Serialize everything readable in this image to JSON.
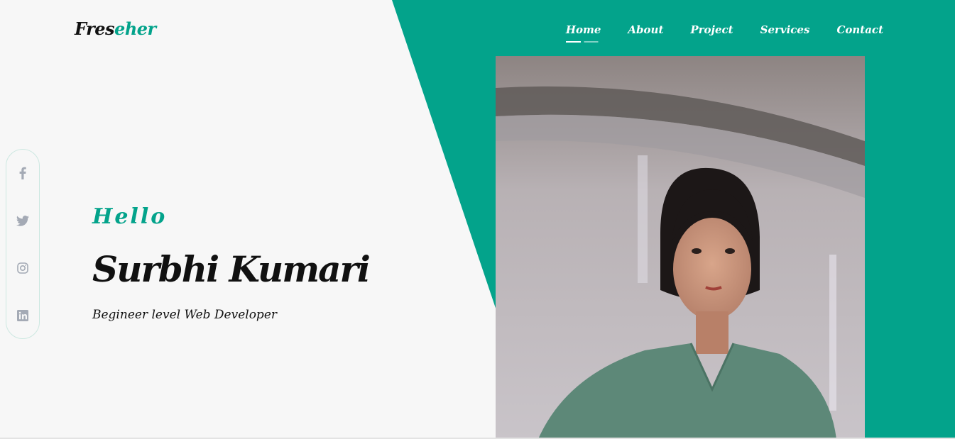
{
  "brand": {
    "part1": "Fres",
    "part2": "eher"
  },
  "nav": {
    "items": [
      {
        "label": "Home",
        "active": true
      },
      {
        "label": "About"
      },
      {
        "label": "Project"
      },
      {
        "label": "Services"
      },
      {
        "label": "Contact"
      }
    ]
  },
  "social": [
    "facebook-icon",
    "twitter-icon",
    "instagram-icon",
    "linkedin-icon"
  ],
  "hero": {
    "greeting": "Hello",
    "name": "Surbhi Kumari",
    "role": "Begineer level Web Developer"
  },
  "colors": {
    "accent": "#03a38b",
    "background": "#f7f7f7",
    "icon": "#a4aab5"
  }
}
